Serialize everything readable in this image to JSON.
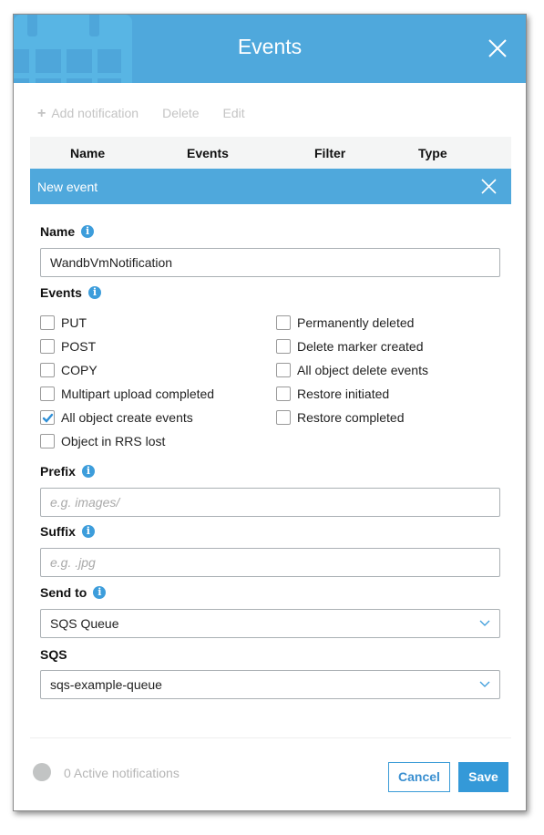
{
  "dialog": {
    "title": "Events",
    "accent_color": "#4fa8dc"
  },
  "toolbar": {
    "add_label": "Add notification",
    "delete_label": "Delete",
    "edit_label": "Edit"
  },
  "table": {
    "columns": [
      "Name",
      "Events",
      "Filter",
      "Type"
    ]
  },
  "new_event": {
    "title": "New event",
    "name": {
      "label": "Name",
      "value": "WandbVmNotification"
    },
    "events": {
      "label": "Events",
      "left": [
        {
          "label": "PUT",
          "checked": false
        },
        {
          "label": "POST",
          "checked": false
        },
        {
          "label": "COPY",
          "checked": false
        },
        {
          "label": "Multipart upload completed",
          "checked": false
        },
        {
          "label": "All object create events",
          "checked": true
        },
        {
          "label": "Object in RRS lost",
          "checked": false
        }
      ],
      "right": [
        {
          "label": "Permanently deleted",
          "checked": false
        },
        {
          "label": "Delete marker created",
          "checked": false
        },
        {
          "label": "All object delete events",
          "checked": false
        },
        {
          "label": "Restore initiated",
          "checked": false
        },
        {
          "label": "Restore completed",
          "checked": false
        }
      ]
    },
    "prefix": {
      "label": "Prefix",
      "value": "",
      "placeholder": "e.g. images/"
    },
    "suffix": {
      "label": "Suffix",
      "value": "",
      "placeholder": "e.g. .jpg"
    },
    "send_to": {
      "label": "Send to",
      "selected": "SQS Queue"
    },
    "sqs": {
      "label": "SQS",
      "selected": "sqs-example-queue"
    }
  },
  "footer": {
    "status_text": "0 Active notifications",
    "cancel_label": "Cancel",
    "save_label": "Save"
  },
  "icons": {
    "add": "plus-icon",
    "close": "close-icon",
    "info": "info-icon",
    "dropdown": "chevron-down-icon",
    "header_graphic": "calendar-icon"
  }
}
